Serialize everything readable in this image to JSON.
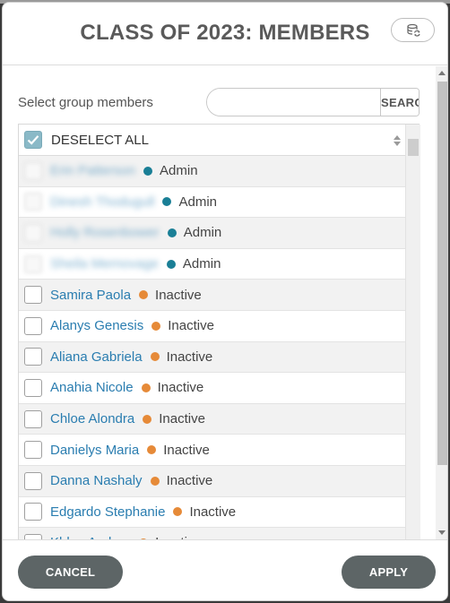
{
  "header": {
    "title": "CLASS OF 2023: MEMBERS",
    "refresh_icon": "refresh-icon"
  },
  "search": {
    "label": "Select group members",
    "value": "",
    "placeholder": "",
    "button": "SEARCH"
  },
  "list": {
    "deselect_all": "DESELECT ALL",
    "members": [
      {
        "name": "Erin Patterson",
        "status": "Admin",
        "type": "admin",
        "blurred": true
      },
      {
        "name": "Dinesh Thodugull",
        "status": "Admin",
        "type": "admin",
        "blurred": true
      },
      {
        "name": "Holly Rosenbower",
        "status": "Admin",
        "type": "admin",
        "blurred": true
      },
      {
        "name": "Sheila Mernovage",
        "status": "Admin",
        "type": "admin",
        "blurred": true
      },
      {
        "name": "Samira Paola",
        "status": "Inactive",
        "type": "inactive",
        "blurred": false
      },
      {
        "name": "Alanys Genesis",
        "status": "Inactive",
        "type": "inactive",
        "blurred": false
      },
      {
        "name": "Aliana Gabriela",
        "status": "Inactive",
        "type": "inactive",
        "blurred": false
      },
      {
        "name": "Anahia Nicole",
        "status": "Inactive",
        "type": "inactive",
        "blurred": false
      },
      {
        "name": "Chloe Alondra",
        "status": "Inactive",
        "type": "inactive",
        "blurred": false
      },
      {
        "name": "Danielys Maria",
        "status": "Inactive",
        "type": "inactive",
        "blurred": false
      },
      {
        "name": "Danna Nashaly",
        "status": "Inactive",
        "type": "inactive",
        "blurred": false
      },
      {
        "name": "Edgardo Stephanie",
        "status": "Inactive",
        "type": "inactive",
        "blurred": false
      },
      {
        "name": "Khloe Andrea",
        "status": "Inactive",
        "type": "inactive",
        "blurred": false
      }
    ]
  },
  "footer": {
    "cancel": "CANCEL",
    "apply": "APPLY"
  },
  "colors": {
    "link": "#2a7db0",
    "admin_dot": "#1a7f96",
    "inactive_dot": "#e68a38",
    "button_bg": "#5d6566",
    "checkbox_checked": "#8ab9c7"
  }
}
